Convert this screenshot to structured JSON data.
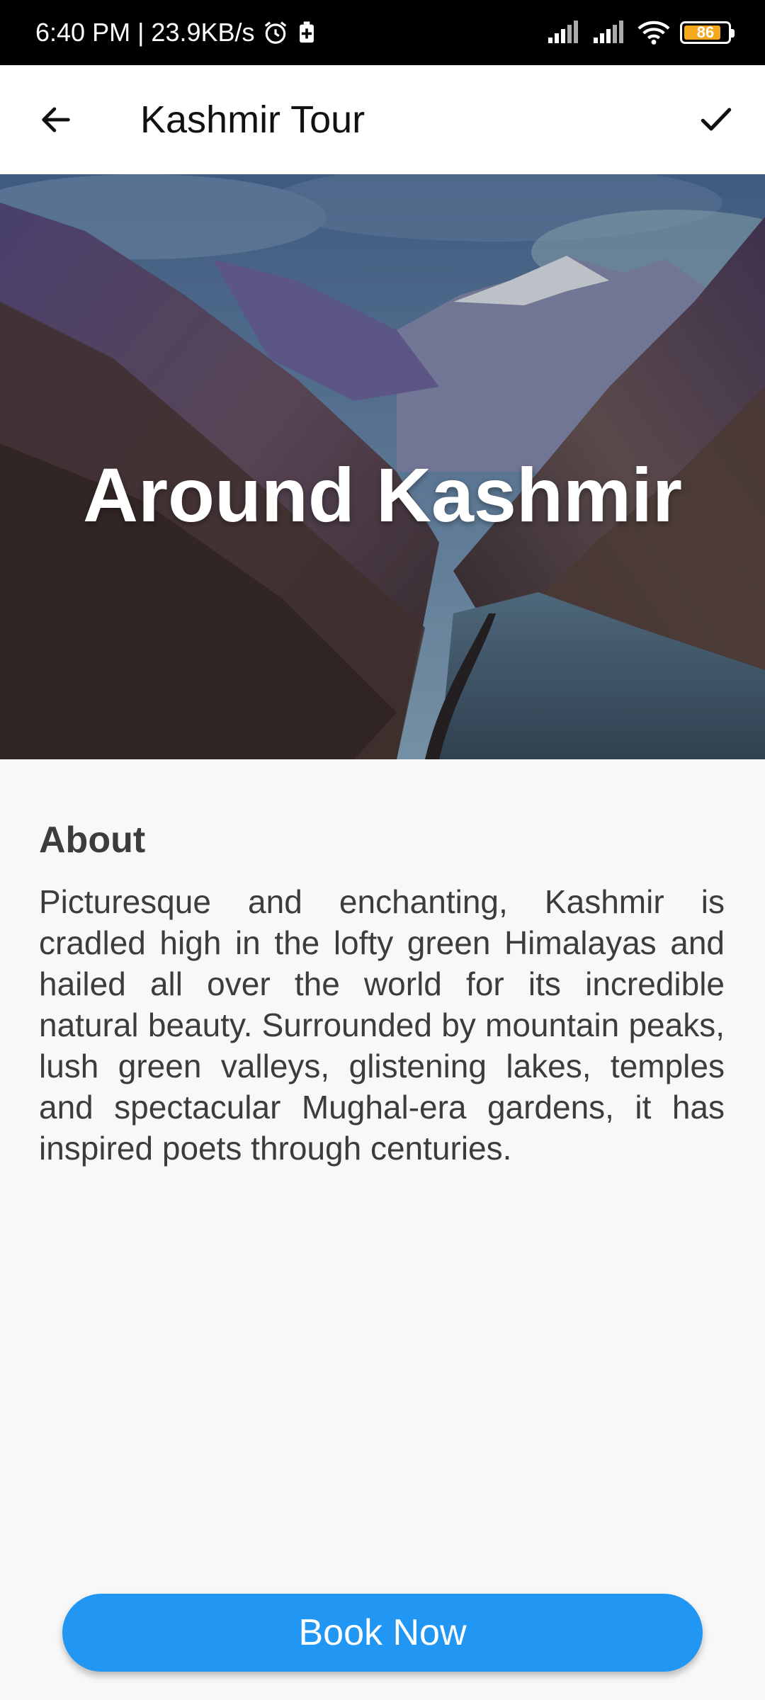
{
  "status_bar": {
    "time_speed": "6:40 PM | 23.9KB/s",
    "battery_level": "86",
    "battery_color": "#f4a81d"
  },
  "app_bar": {
    "title": "Kashmir Tour",
    "back_icon": "arrow-back-icon",
    "confirm_icon": "check-icon"
  },
  "hero": {
    "title": "Around Kashmir"
  },
  "about": {
    "heading": "About",
    "body": "Picturesque and enchanting, Kashmir is cradled high in the lofty green Himalayas and hailed all over the world for its incredible natural beauty. Surrounded by mountain peaks, lush green valleys, glistening lakes, temples and spectacular Mughal-era gardens, it has inspired poets through centuries."
  },
  "actions": {
    "book_label": "Book Now",
    "accent": "#2196f3"
  }
}
